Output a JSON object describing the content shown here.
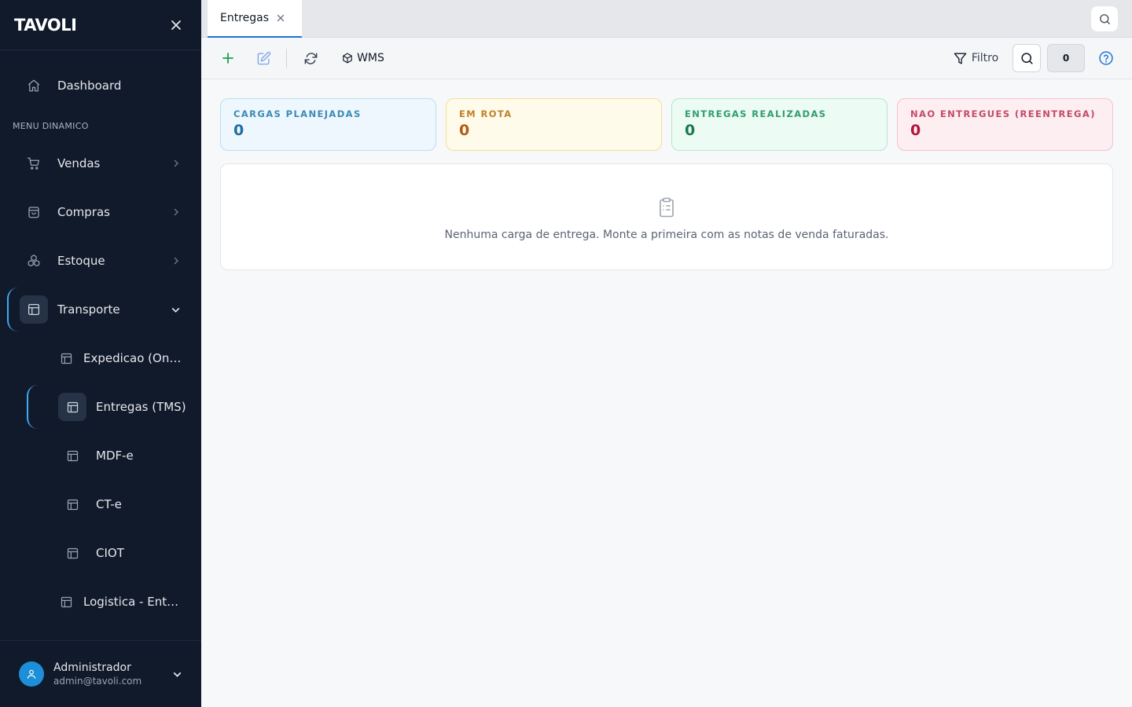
{
  "brand": {
    "logo": "TAVOLI"
  },
  "sidebar": {
    "dashboard": "Dashboard",
    "section_label": "MENU DINAMICO",
    "items": {
      "vendas": "Vendas",
      "compras": "Compras",
      "estoque": "Estoque",
      "transporte": "Transporte"
    },
    "subitems": {
      "expedicao": "Expedicao (Ondas)",
      "entregas": "Entregas (TMS)",
      "mdfe": "MDF-e",
      "cte": "CT-e",
      "ciot": "CIOT",
      "logistica": "Logistica - Entregas"
    },
    "active_item": "Entregas (TMS)"
  },
  "user": {
    "name": "Administrador",
    "email": "admin@tavoli.com"
  },
  "tabs": [
    {
      "label": "Entregas"
    }
  ],
  "toolbar": {
    "wms_label": "WMS",
    "filter_label": "Filtro",
    "count": "0"
  },
  "stats": [
    {
      "title": "CARGAS PLANEJADAS",
      "value": "0"
    },
    {
      "title": "EM ROTA",
      "value": "0"
    },
    {
      "title": "ENTREGAS REALIZADAS",
      "value": "0"
    },
    {
      "title": "NAO ENTREGUES (REENTREGA)",
      "value": "0"
    }
  ],
  "empty_state": {
    "message": "Nenhuma carga de entrega. Monte a primeira com as notas de venda faturadas."
  },
  "colors": {
    "sidebar_bg": "#111a2b",
    "accent": "#3fa9f5",
    "planned": "#3a8bb5",
    "in_route": "#c0802a",
    "delivered": "#2f9e6f",
    "not_delivered": "#c24a6a"
  }
}
